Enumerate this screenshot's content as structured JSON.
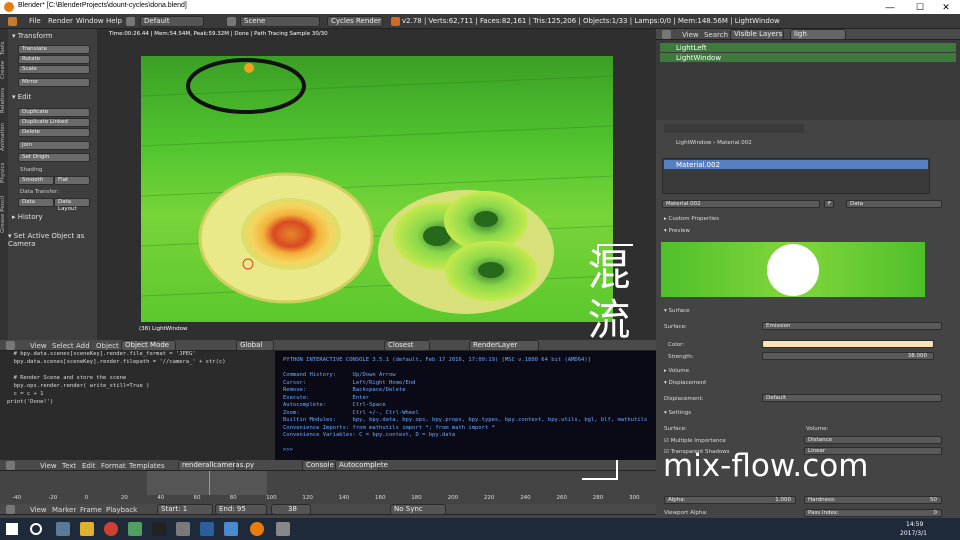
{
  "window": {
    "title": "Blender* [C:\\BlenderProjects\\dount-cycles\\dona.blend]",
    "minimize": "—",
    "maximize": "☐",
    "close": "✕"
  },
  "menu": {
    "items": [
      "File",
      "Render",
      "Window",
      "Help"
    ],
    "layout": "Default",
    "scene": "Scene",
    "engine": "Cycles Render",
    "stats": "v2.78 | Verts:62,711 | Faces:82,161 | Tris:125,206 | Objects:1/33 | Lamps:0/0 | Mem:148.56M | LightWindow"
  },
  "toolshelf": {
    "tabs": [
      "Tools",
      "Create",
      "Relations",
      "Animation",
      "Physics",
      "Grease Pencil"
    ],
    "transform_header": "Transform",
    "transform_buttons": [
      "Translate",
      "Rotate",
      "Scale",
      "Mirror"
    ],
    "edit_header": "Edit",
    "edit_buttons": [
      "Duplicate",
      "Duplicate Linked",
      "Delete",
      "Join"
    ],
    "set_origin": "Set Origin",
    "shading_label": "Shading",
    "smooth": "Smooth",
    "flat": "Flat",
    "data_transfer_label": "Data Transfer:",
    "data": "Data",
    "data_layout": "Data Layout",
    "history": "History",
    "set_active": "Set Active Object as Camera"
  },
  "viewport": {
    "render_info": "Time:00:26.44 | Mem:54.54M, Peak:59.32M | Done | Path Tracing Sample 30/30",
    "object_label": "(38) LightWindow",
    "header": {
      "menus": [
        "View",
        "Select",
        "Add",
        "Object"
      ],
      "mode": "Object Mode",
      "pivot": "Global",
      "snap": "Closest",
      "layer": "RenderLayer"
    }
  },
  "text_editor": {
    "lines": [
      "  # bpy.data.scenes[sceneKey].render.file_format = 'JPEG'",
      "  bpy.data.scenes[sceneKey].render.filepath = '//camera_' + str(c)",
      "",
      "  # Render Scene and store the scene",
      "  bpy.ops.render.render( write_still=True )",
      "  c = c + 1",
      "print('Done!')"
    ],
    "header": {
      "menus": [
        "View",
        "Text",
        "Edit",
        "Format",
        "Templates"
      ],
      "file": "renderallcameras.py"
    }
  },
  "console": {
    "lines": [
      "PYTHON INTERACTIVE CONSOLE 3.5.1 (default, Feb 17 2016, 17:09:19) [MSC v.1800 64 bit (AMD64)]",
      "",
      "Command History:     Up/Down Arrow",
      "Cursor:              Left/Right Home/End",
      "Remove:              Backspace/Delete",
      "Execute:             Enter",
      "Autocomplete:        Ctrl-Space",
      "Zoom:                Ctrl +/-, Ctrl-Wheel",
      "Builtin Modules:     bpy, bpy.data, bpy.ops, bpy.props, bpy.types, bpy.context, bpy.utils, bgl, blf, mathutils",
      "Convenience Imports: from mathutils import *; from math import *",
      "Convenience Variables: C = bpy.context, D = bpy.data",
      "",
      ">>> "
    ],
    "tabs": [
      "Console",
      "Autocomplete"
    ]
  },
  "timeline": {
    "ticks": [
      "-40",
      "-20",
      "0",
      "20",
      "40",
      "60",
      "80",
      "100",
      "120",
      "140",
      "160",
      "180",
      "200",
      "220",
      "240",
      "260",
      "280",
      "300"
    ],
    "menus": [
      "View",
      "Marker",
      "Frame",
      "Playback"
    ],
    "start_label": "Start:",
    "start": "1",
    "end_label": "End:",
    "end": "95",
    "current": "38",
    "sync": "No Sync"
  },
  "outliner": {
    "menus": [
      "View",
      "Search"
    ],
    "filter": "Visible Layers",
    "search": "ligh",
    "items": [
      "LightLeft",
      "LightWindow"
    ]
  },
  "properties": {
    "breadcrumb": [
      "LightWindow",
      "Material.002"
    ],
    "slot": "Material.002",
    "material_name": "Material.002",
    "fake_user": "F",
    "data_dropdown": "Data",
    "custom_properties": "Custom Properties",
    "preview": "Preview",
    "surface_header": "Surface",
    "surface_label": "Surface:",
    "surface_shader": "Emission",
    "color_label": "Color:",
    "strength_label": "Strength:",
    "strength": "38.000",
    "volume": "Volume",
    "displacement_header": "Displacement",
    "displacement_label": "Displacement:",
    "displacement": "Default",
    "settings": "Settings",
    "s_surface": "Surface:",
    "s_volume": "Volume:",
    "multiple_importance": "Multiple Importance",
    "transparent_shadows": "Transparent Shadows",
    "distance": "Distance",
    "linear": "Linear",
    "alpha_label": "Alpha:",
    "alpha": "1.000",
    "hardness_label": "Hardness:",
    "hardness": "50",
    "viewport_alpha": "Viewport Alpha:",
    "pass_index": "Pass Index:",
    "pass_value": "0",
    "emission_color": "#fbe2b8"
  },
  "taskbar": {
    "time": "14:59",
    "date": "2017/3/1"
  },
  "watermark": {
    "kanji": [
      "混",
      "流"
    ],
    "site": "mix-flow.com"
  }
}
